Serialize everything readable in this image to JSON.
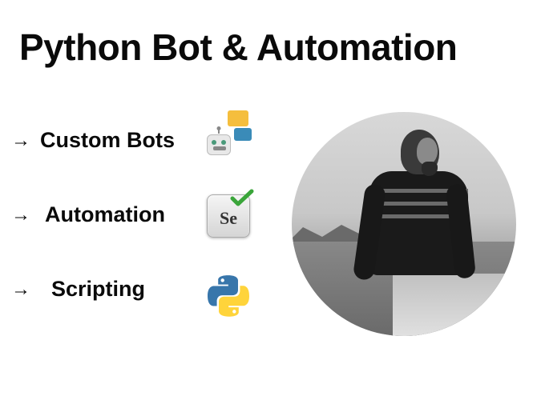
{
  "title": "Python Bot & Automation",
  "features": [
    {
      "label": "Custom Bots",
      "icon": "chatbot-icon"
    },
    {
      "label": "Automation",
      "icon": "selenium-icon"
    },
    {
      "label": "Scripting",
      "icon": "python-icon"
    }
  ],
  "selenium_badge_text": "Se",
  "arrow_glyph": "→"
}
